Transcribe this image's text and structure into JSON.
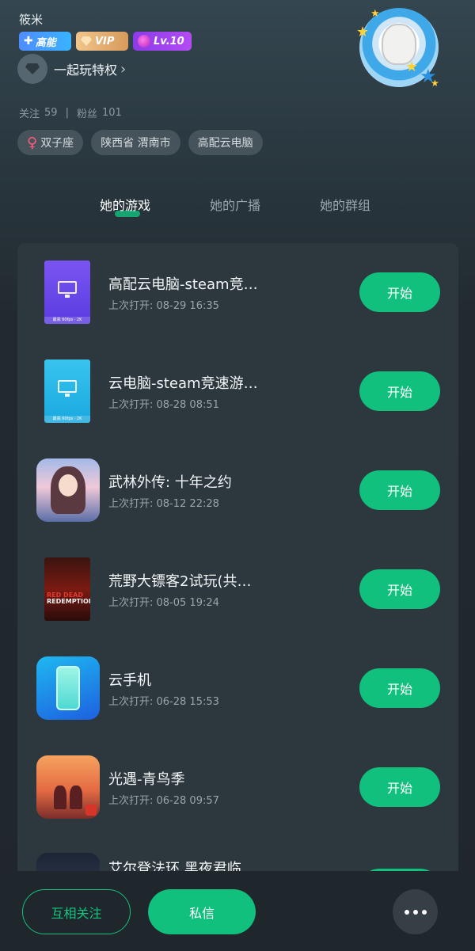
{
  "profile": {
    "username": "筱米",
    "badges": {
      "energy": "高能",
      "vip": "VIP",
      "level": "Lv.10"
    },
    "privilege_label": "一起玩特权",
    "following_label": "关注",
    "following_count": "59",
    "followers_label": "粉丝",
    "followers_count": "101",
    "tags": [
      "双子座",
      "陕西省 渭南市",
      "高配云电脑"
    ]
  },
  "tabs": [
    "她的游戏",
    "她的广播",
    "她的群组"
  ],
  "active_tab": 0,
  "games": [
    {
      "title": "高配云电脑-steam竞…",
      "last_opened": "上次打开: 08-29 16:35",
      "button": "开始",
      "icon": "cloud-pc-purple-icon",
      "icon_caption": "最高 60fps · 2K"
    },
    {
      "title": "云电脑-steam竞速游…",
      "last_opened": "上次打开: 08-28 08:51",
      "button": "开始",
      "icon": "cloud-pc-cyan-icon",
      "icon_caption": "最高 60fps · 2K"
    },
    {
      "title": "武林外传: 十年之约",
      "last_opened": "上次打开: 08-12 22:28",
      "button": "开始",
      "icon": "wulin-game-icon"
    },
    {
      "title": "荒野大镖客2试玩(共…",
      "last_opened": "上次打开: 08-05 19:24",
      "button": "开始",
      "icon": "red-dead-icon"
    },
    {
      "title": "云手机",
      "last_opened": "上次打开: 06-28 15:53",
      "button": "开始",
      "icon": "cloud-phone-icon"
    },
    {
      "title": "光遇-青鸟季",
      "last_opened": "上次打开: 06-28 09:57",
      "button": "开始",
      "icon": "sky-game-icon"
    }
  ],
  "partial_game": {
    "title": "艾尔登法环 黑夜君临",
    "icon": "nightreign-icon"
  },
  "bottom_bar": {
    "follow": "互相关注",
    "message": "私信",
    "more_icon": "more-dots-icon"
  },
  "colors": {
    "accent": "#10c07c",
    "background": "#222a30",
    "card": "#2d373e"
  }
}
